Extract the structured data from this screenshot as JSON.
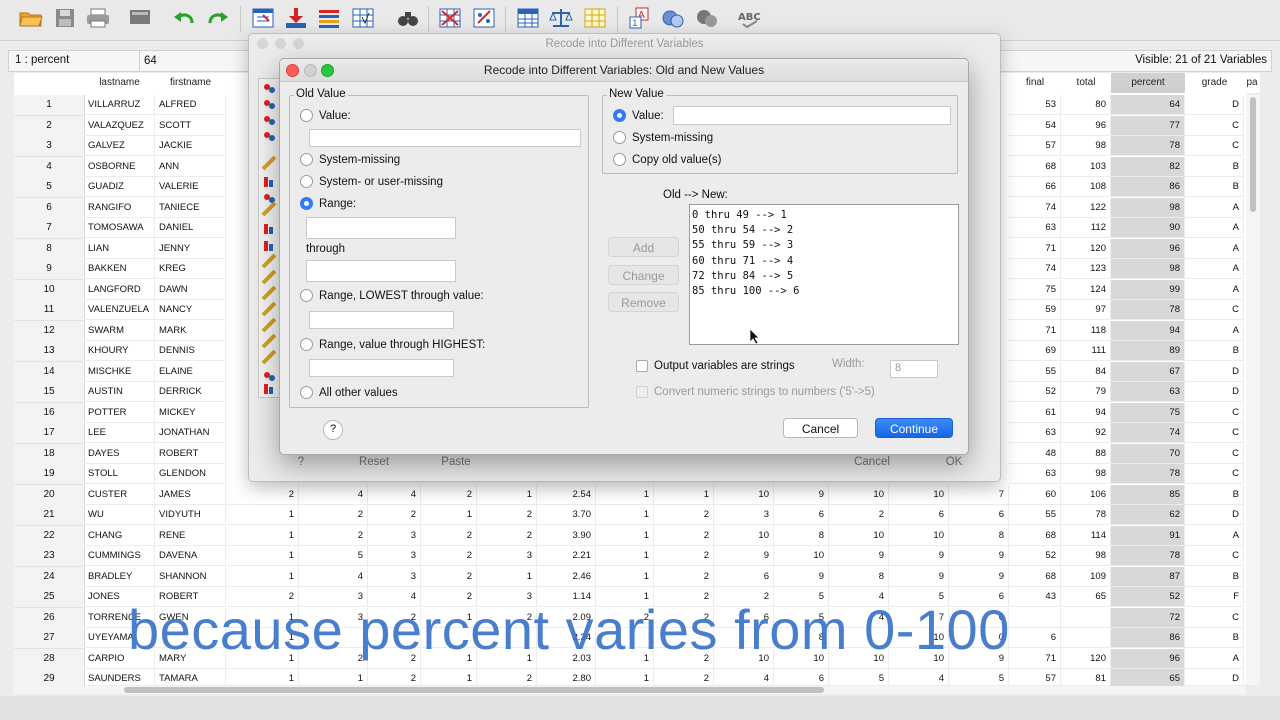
{
  "toolbar": {
    "icons": [
      "open-folder-icon",
      "save-icon",
      "print-icon",
      "dialog-recall-icon",
      "undo-icon",
      "redo-icon",
      "goto-case-icon",
      "goto-variable-icon",
      "variables-icon",
      "run-descriptives-icon",
      "find-icon",
      "split-file-icon",
      "select-cases-icon",
      "insert-cases-icon",
      "weight-cases-icon",
      "value-labels-icon",
      "use-sets-icon",
      "show-sets-icon",
      "spell-check-icon"
    ]
  },
  "cellbar": {
    "ref": "1 : percent",
    "value": "64",
    "visible": "Visible: 21 of 21 Variables"
  },
  "grid": {
    "left_headers": [
      "lastname",
      "firstname"
    ],
    "right_headers": [
      "final",
      "total",
      "percent",
      "grade",
      "pa"
    ],
    "rows": [
      {
        "n": "1",
        "last": "VILLARRUZ",
        "first": "ALFRED",
        "final": "53",
        "total": "80",
        "percent": "64",
        "grade": "D"
      },
      {
        "n": "2",
        "last": "VALAZQUEZ",
        "first": "SCOTT",
        "final": "54",
        "total": "96",
        "percent": "77",
        "grade": "C"
      },
      {
        "n": "3",
        "last": "GALVEZ",
        "first": "JACKIE",
        "final": "57",
        "total": "98",
        "percent": "78",
        "grade": "C"
      },
      {
        "n": "4",
        "last": "OSBORNE",
        "first": "ANN",
        "final": "68",
        "total": "103",
        "percent": "82",
        "grade": "B"
      },
      {
        "n": "5",
        "last": "GUADIZ",
        "first": "VALERIE",
        "final": "66",
        "total": "108",
        "percent": "86",
        "grade": "B"
      },
      {
        "n": "6",
        "last": "RANGIFO",
        "first": "TANIECE",
        "final": "74",
        "total": "122",
        "percent": "98",
        "grade": "A"
      },
      {
        "n": "7",
        "last": "TOMOSAWA",
        "first": "DANIEL",
        "final": "63",
        "total": "112",
        "percent": "90",
        "grade": "A"
      },
      {
        "n": "8",
        "last": "LIAN",
        "first": "JENNY",
        "final": "71",
        "total": "120",
        "percent": "96",
        "grade": "A"
      },
      {
        "n": "9",
        "last": "BAKKEN",
        "first": "KREG",
        "final": "74",
        "total": "123",
        "percent": "98",
        "grade": "A"
      },
      {
        "n": "10",
        "last": "LANGFORD",
        "first": "DAWN",
        "final": "75",
        "total": "124",
        "percent": "99",
        "grade": "A"
      },
      {
        "n": "11",
        "last": "VALENZUELA",
        "first": "NANCY",
        "final": "59",
        "total": "97",
        "percent": "78",
        "grade": "C"
      },
      {
        "n": "12",
        "last": "SWARM",
        "first": "MARK",
        "final": "71",
        "total": "118",
        "percent": "94",
        "grade": "A"
      },
      {
        "n": "13",
        "last": "KHOURY",
        "first": "DENNIS",
        "final": "69",
        "total": "111",
        "percent": "89",
        "grade": "B"
      },
      {
        "n": "14",
        "last": "MISCHKE",
        "first": "ELAINE",
        "final": "55",
        "total": "84",
        "percent": "67",
        "grade": "D"
      },
      {
        "n": "15",
        "last": "AUSTIN",
        "first": "DERRICK",
        "final": "52",
        "total": "79",
        "percent": "63",
        "grade": "D"
      },
      {
        "n": "16",
        "last": "POTTER",
        "first": "MICKEY",
        "final": "61",
        "total": "94",
        "percent": "75",
        "grade": "C"
      },
      {
        "n": "17",
        "last": "LEE",
        "first": "JONATHAN",
        "final": "63",
        "total": "92",
        "percent": "74",
        "grade": "C"
      },
      {
        "n": "18",
        "last": "DAYES",
        "first": "ROBERT",
        "final": "48",
        "total": "88",
        "percent": "70",
        "grade": "C"
      },
      {
        "n": "19",
        "last": "STOLL",
        "first": "GLENDON",
        "final": "63",
        "total": "98",
        "percent": "78",
        "grade": "C"
      },
      {
        "n": "20",
        "last": "CUSTER",
        "first": "JAMES",
        "mid": [
          "2",
          "4",
          "4",
          "2",
          "1",
          "2.54",
          "1",
          "1",
          "10",
          "9",
          "10",
          "10",
          "7"
        ],
        "final": "60",
        "total": "106",
        "percent": "85",
        "grade": "B"
      },
      {
        "n": "21",
        "last": "WU",
        "first": "VIDYUTH",
        "mid": [
          "1",
          "2",
          "2",
          "1",
          "2",
          "3.70",
          "1",
          "2",
          "3",
          "6",
          "2",
          "6",
          "6"
        ],
        "final": "55",
        "total": "78",
        "percent": "62",
        "grade": "D"
      },
      {
        "n": "22",
        "last": "CHANG",
        "first": "RENE",
        "mid": [
          "1",
          "2",
          "3",
          "2",
          "2",
          "3.90",
          "1",
          "2",
          "10",
          "8",
          "10",
          "10",
          "8"
        ],
        "final": "68",
        "total": "114",
        "percent": "91",
        "grade": "A"
      },
      {
        "n": "23",
        "last": "CUMMINGS",
        "first": "DAVENA",
        "mid": [
          "1",
          "5",
          "3",
          "2",
          "3",
          "2.21",
          "1",
          "2",
          "9",
          "10",
          "9",
          "9",
          "9"
        ],
        "final": "52",
        "total": "98",
        "percent": "78",
        "grade": "C"
      },
      {
        "n": "24",
        "last": "BRADLEY",
        "first": "SHANNON",
        "mid": [
          "1",
          "4",
          "3",
          "2",
          "1",
          "2.46",
          "1",
          "2",
          "6",
          "9",
          "8",
          "9",
          "9"
        ],
        "final": "68",
        "total": "109",
        "percent": "87",
        "grade": "B"
      },
      {
        "n": "25",
        "last": "JONES",
        "first": "ROBERT",
        "mid": [
          "2",
          "3",
          "4",
          "2",
          "3",
          "1.14",
          "1",
          "2",
          "2",
          "5",
          "4",
          "5",
          "6"
        ],
        "final": "43",
        "total": "65",
        "percent": "52",
        "grade": "F"
      },
      {
        "n": "26",
        "last": "TORRENCE",
        "first": "GWEN",
        "mid": [
          "1",
          "3",
          "2",
          "1",
          "2",
          "2.09",
          "2",
          "2",
          "6",
          "5",
          "4",
          "7",
          "6"
        ],
        "final": "",
        "total": "",
        "percent": "72",
        "grade": "C"
      },
      {
        "n": "27",
        "last": "UYEYAMA",
        "first": "",
        "mid": [
          "1",
          "",
          "",
          "",
          "",
          "2.34",
          "",
          "",
          "",
          "8",
          "",
          "10",
          "0"
        ],
        "final": "6",
        "total": "",
        "percent": "86",
        "grade": "B"
      },
      {
        "n": "28",
        "last": "CARPIO",
        "first": "MARY",
        "mid": [
          "1",
          "2",
          "2",
          "1",
          "1",
          "2.03",
          "1",
          "2",
          "10",
          "10",
          "10",
          "10",
          "9"
        ],
        "final": "71",
        "total": "120",
        "percent": "96",
        "grade": "A"
      },
      {
        "n": "29",
        "last": "SAUNDERS",
        "first": "TAMARA",
        "mid": [
          "1",
          "1",
          "2",
          "1",
          "2",
          "2.80",
          "1",
          "2",
          "4",
          "6",
          "5",
          "4",
          "5"
        ],
        "final": "57",
        "total": "81",
        "percent": "65",
        "grade": "D"
      }
    ]
  },
  "bg_dialog": {
    "title": "Recode into Different Variables",
    "reset": "Reset",
    "paste": "Paste",
    "cancel": "Cancel",
    "ok": "OK"
  },
  "dialog": {
    "title": "Recode into Different Variables: Old and New Values",
    "old_value": {
      "legend": "Old Value",
      "value": "Value:",
      "system_missing": "System-missing",
      "sys_or_user_missing": "System- or user-missing",
      "range": "Range:",
      "through": "through",
      "range_lowest": "Range, LOWEST through value:",
      "range_highest": "Range, value through HIGHEST:",
      "all_other": "All other values"
    },
    "new_value": {
      "legend": "New Value",
      "value": "Value:",
      "system_missing": "System-missing",
      "copy_old": "Copy old value(s)"
    },
    "old_new_label": "Old --> New:",
    "mappings": [
      "0 thru 49 --> 1",
      "50 thru 54 --> 2",
      "55 thru 59 --> 3",
      "60 thru 71 --> 4",
      "72 thru 84 --> 5",
      "85 thru 100 --> 6"
    ],
    "add": "Add",
    "change": "Change",
    "remove": "Remove",
    "output_strings": "Output variables are strings",
    "width_label": "Width:",
    "width_value": "8",
    "convert_numeric": "Convert numeric strings to numbers ('5'->5)",
    "help": "?",
    "cancel": "Cancel",
    "continue": "Continue"
  },
  "caption": "because percent varies from 0-100"
}
